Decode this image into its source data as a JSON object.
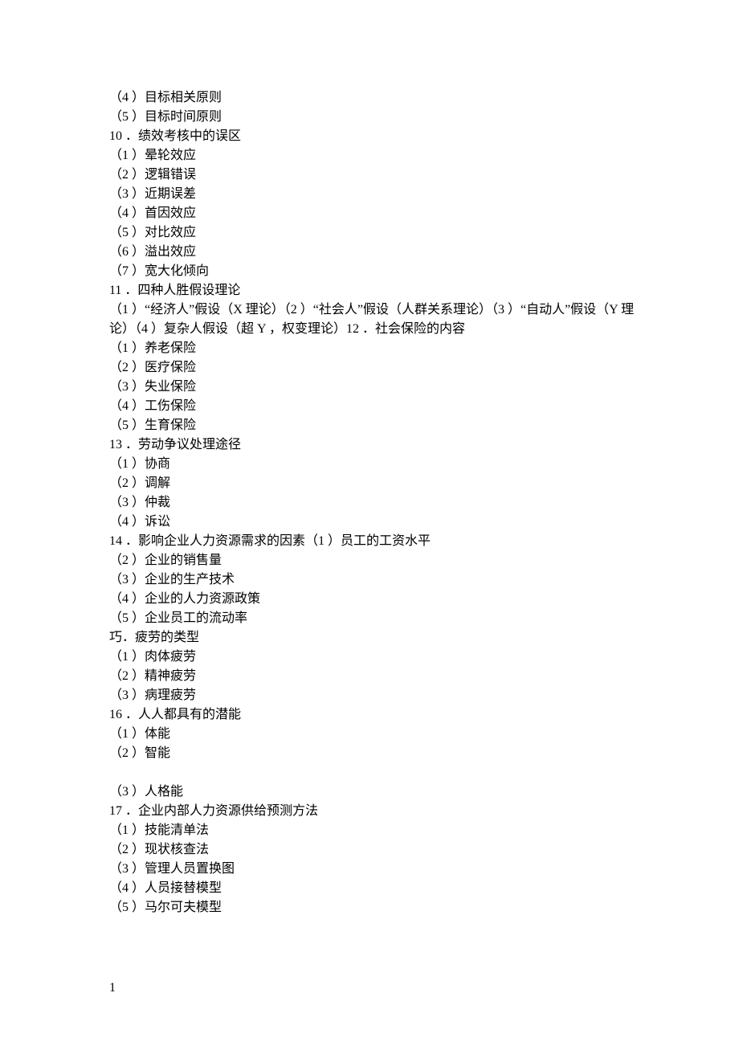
{
  "lines": [
    "（4 ）目标相关原则",
    "（5 ）目标时间原则",
    "10 ．绩效考核中的误区",
    "（1 ）晕轮效应",
    "（2 ）逻辑错误",
    "（3 ）近期误差",
    "（4 ）首因效应",
    "（5 ）对比效应",
    "（6 ）溢出效应",
    "（7 ）宽大化倾向",
    "11 ．四种人胜假设理论",
    "（1 ）“经济人”假设（X 理论）（2 ）“社会人”假设（人群关系理论）（3 ）“自动人”假设（Y 理论）（4 ）复杂人假设（超 Y ，权变理论）12 ．社会保险的内容",
    "（1 ）养老保险",
    "（2 ）医疗保险",
    "（3 ）失业保险",
    "（4 ）工伤保险",
    "（5 ）生育保险",
    "13 ．劳动争议处理途径",
    "（1 ）协商",
    "（2 ）调解",
    "（3 ）仲裁",
    "（4 ）诉讼",
    "14 ．影响企业人力资源需求的因素（1 ）员工的工资水平",
    "（2 ）企业的销售量",
    "（3 ）企业的生产技术",
    "（4 ）企业的人力资源政策",
    "（5 ）企业员工的流动率",
    "巧．疲劳的类型",
    "（1 ）肉体疲劳",
    "（2 ）精神疲劳",
    "（3 ）病理疲劳",
    "16 ．人人都具有的潜能",
    "（1 ）体能",
    "（2 ）智能"
  ],
  "lines_after_gap": [
    "（3 ）人格能",
    "17 ．企业内部人力资源供给预测方法",
    "（1 ）技能清单法",
    "（2 ）现状核查法",
    "（3 ）管理人员置换图",
    "（4 ）人员接替模型",
    "（5 ）马尔可夫模型"
  ],
  "page_number": "1"
}
